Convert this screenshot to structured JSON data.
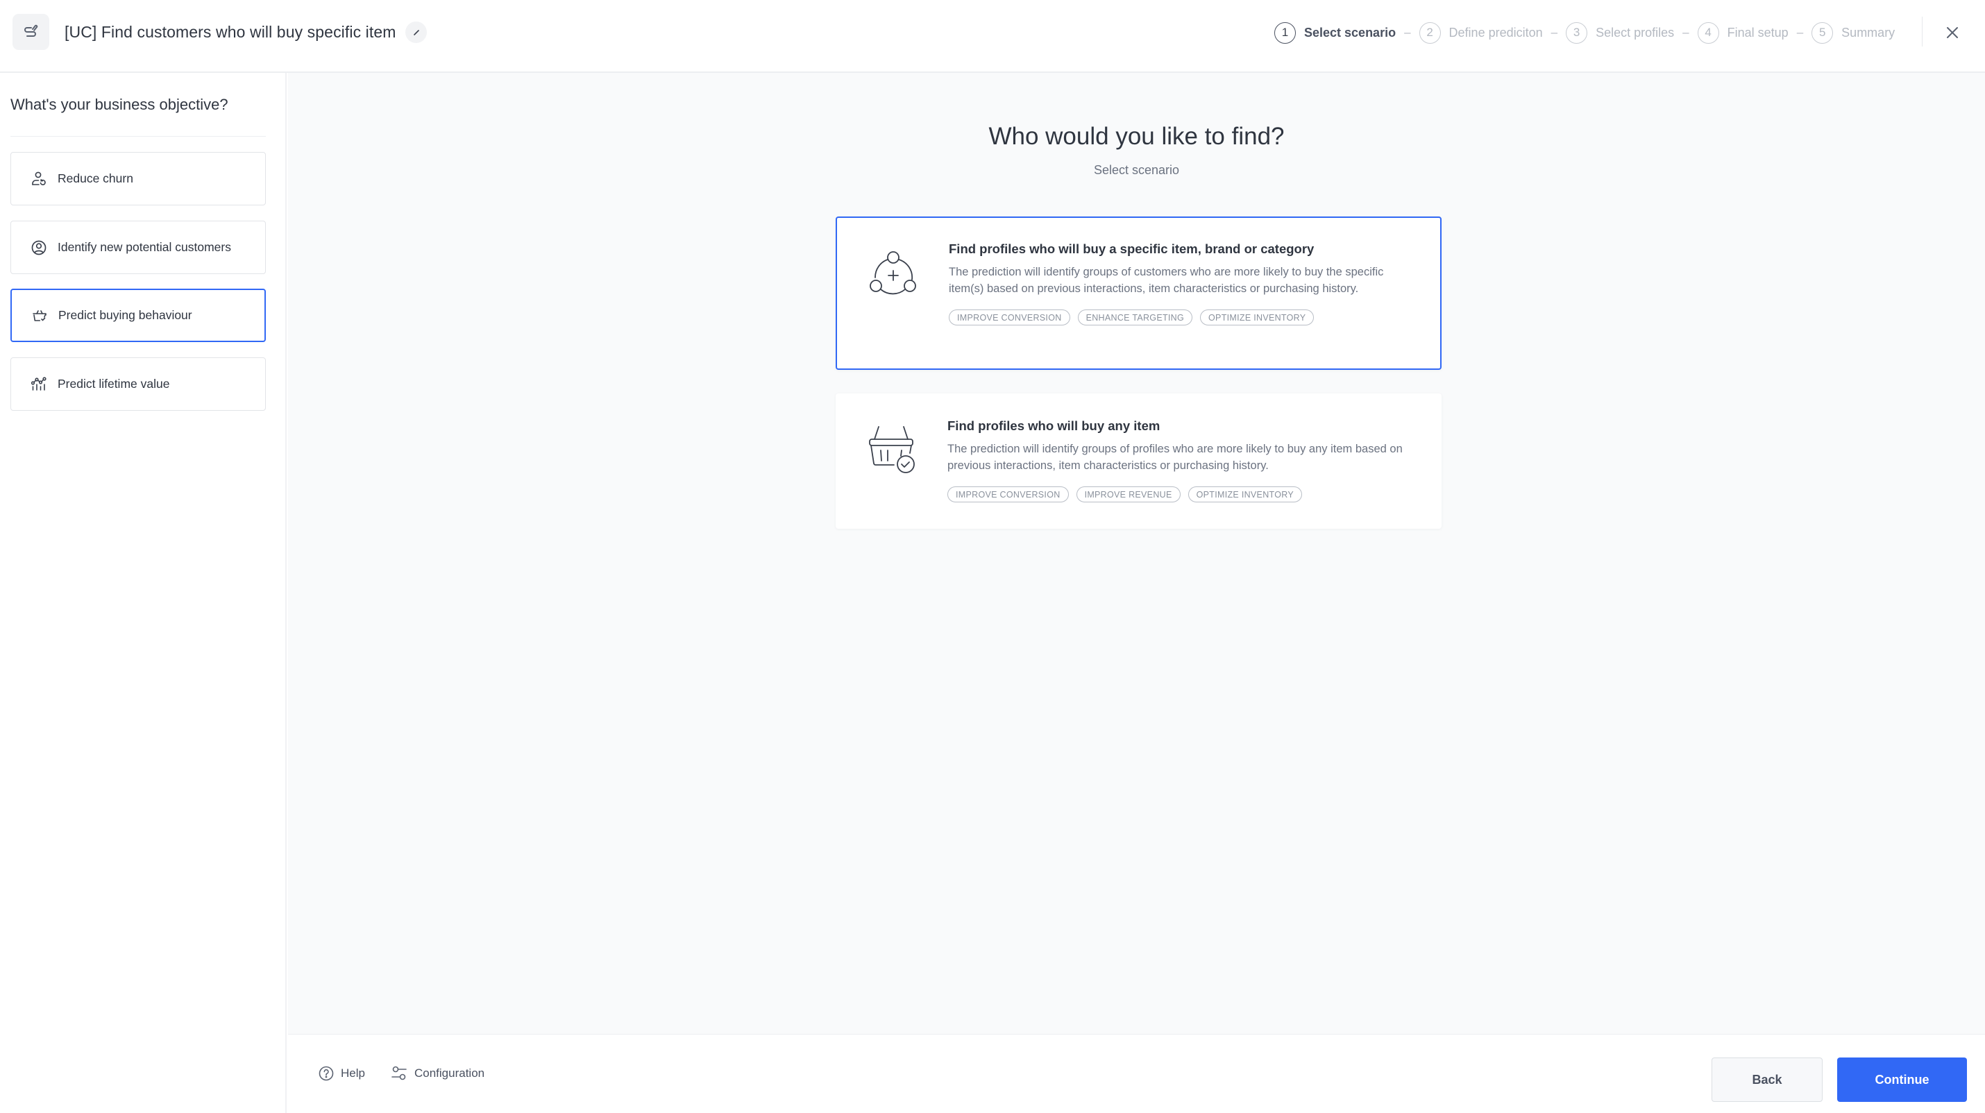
{
  "header": {
    "logo_icon": "prediction-flow-icon",
    "title": "[UC] Find customers who will buy specific item",
    "edit_icon": "pencil-icon",
    "close_icon": "close-icon",
    "steps": [
      {
        "number": "1",
        "label": "Select scenario",
        "active": true
      },
      {
        "number": "2",
        "label": "Define prediciton",
        "active": false
      },
      {
        "number": "3",
        "label": "Select profiles",
        "active": false
      },
      {
        "number": "4",
        "label": "Final setup",
        "active": false
      },
      {
        "number": "5",
        "label": "Summary",
        "active": false
      }
    ],
    "step_separator": "–"
  },
  "sidebar": {
    "heading": "What's your business objective?",
    "items": [
      {
        "label": "Reduce churn",
        "icon": "user-refresh-icon",
        "selected": false
      },
      {
        "label": "Identify new potential customers",
        "icon": "user-circle-icon",
        "selected": false
      },
      {
        "label": "Predict buying behaviour",
        "icon": "basket-check-icon",
        "selected": true
      },
      {
        "label": "Predict lifetime value",
        "icon": "chart-points-icon",
        "selected": false
      }
    ]
  },
  "main": {
    "title": "Who would you like to find?",
    "subtitle": "Select scenario",
    "scenarios": [
      {
        "title": "Find profiles who will buy a specific item, brand or category",
        "description": "The prediction will identify groups of customers who are more likely to buy the specific item(s) based on previous interactions, item characteristics or purchasing history.",
        "tags": [
          "IMPROVE CONVERSION",
          "ENHANCE TARGETING",
          "OPTIMIZE INVENTORY"
        ],
        "icon": "cycle-add-icon",
        "selected": true
      },
      {
        "title": "Find profiles who will buy any item",
        "description": "The prediction will identify groups of profiles who are more likely to buy any item based on previous interactions, item characteristics or purchasing history.",
        "tags": [
          "IMPROVE CONVERSION",
          "IMPROVE REVENUE",
          "OPTIMIZE INVENTORY"
        ],
        "icon": "basket-check-icon",
        "selected": false
      }
    ]
  },
  "footer": {
    "help_label": "Help",
    "configuration_label": "Configuration",
    "back_label": "Back",
    "continue_label": "Continue"
  },
  "colors": {
    "accent": "#3168F5",
    "text_primary": "#2F3540",
    "text_secondary": "#6B7280",
    "main_background": "#F9FAFB"
  }
}
